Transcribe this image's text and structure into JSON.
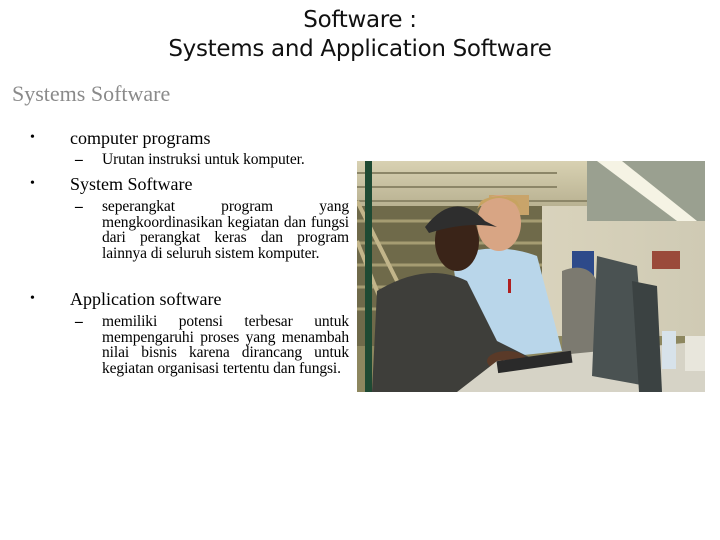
{
  "slide": {
    "title_line1": "Software :",
    "title_line2": "Systems and Application Software",
    "subtitle": "Systems Software"
  },
  "bullets": [
    {
      "label": "computer programs",
      "sub": "Urutan instruksi untuk komputer."
    },
    {
      "label": "System Software",
      "sub": "seperangkat program yang mengkoordinasikan kegiatan dan fungsi dari perangkat keras dan program lainnya di seluruh sistem komputer."
    },
    {
      "label": "Application software",
      "sub": "memiliki potensi terbesar untuk mempengaruhi proses yang menambah nilai bisnis karena dirancang untuk kegiatan organisasi tertentu dan fungsi."
    }
  ],
  "symbols": {
    "bullet": "•",
    "dash": "–"
  },
  "photo": {
    "description": "Two men looking at a computer monitor in a warehouse parts office",
    "colors": {
      "ceiling": "#c9c2a4",
      "shelving": "#6d6a4c",
      "shirt_light_blue": "#b9d6ea",
      "jacket_dark": "#3f3f3b",
      "monitor": "#4a5050",
      "counter": "#d8d5c8"
    }
  }
}
